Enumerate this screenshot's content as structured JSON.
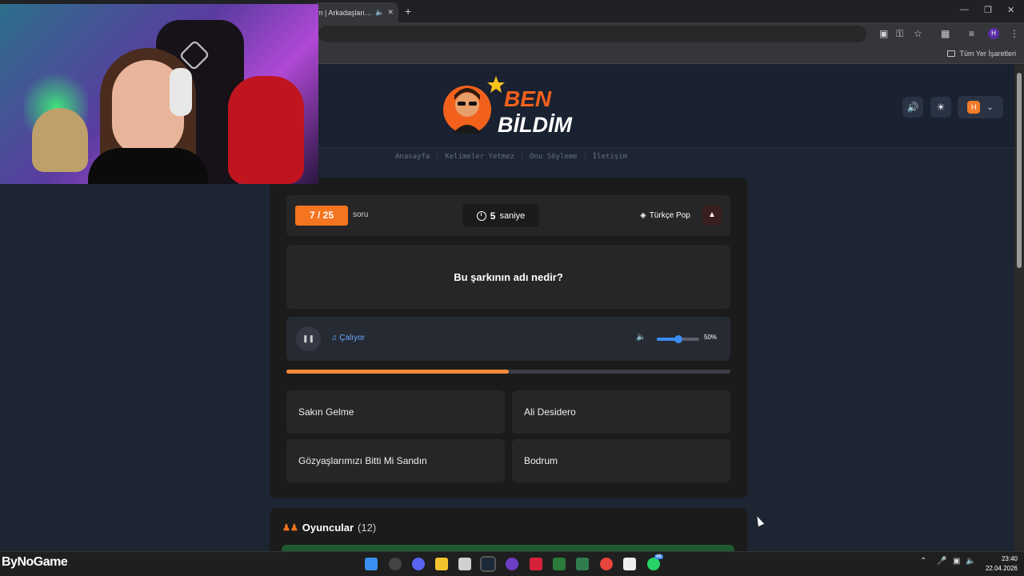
{
  "browser": {
    "tab_title": "m | Arkadaşlarınla",
    "new_tab": "+",
    "bookmarks_all": "Tüm Yer İşaretleri",
    "profile_initial": "H"
  },
  "site": {
    "logo_line1": "BEN",
    "logo_line2": "BİLDİM",
    "nav": [
      "Anasayfa",
      "Kelimeler Yetmez",
      "Onu Söyleme",
      "İletişim"
    ],
    "user_initial": "H",
    "accent": "#f5741f"
  },
  "game": {
    "question_counter": "7 / 25",
    "question_word": "soru",
    "timer_value": "5",
    "timer_unit": "saniye",
    "category": "Türkçe Pop",
    "question": "Bu şarkının adı nedir?",
    "status": "Çalıyor",
    "volume_level": 0.5,
    "volume_label": "50%",
    "song_progress": 0.5,
    "answers": [
      "Sakın Gelme",
      "Ali Desidero",
      "Gözyaşlarımızı Bitti Mi Sandın",
      "Bodrum"
    ]
  },
  "players": {
    "title": "Oyuncular",
    "count": "(12)"
  },
  "taskbar": {
    "time": "23:40",
    "date": "22.04.2026",
    "whatsapp_badge": "46"
  },
  "overlay": {
    "watermark": "ByNoGame"
  }
}
